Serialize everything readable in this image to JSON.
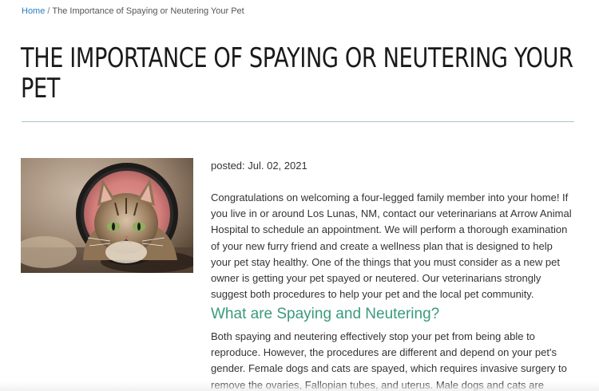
{
  "breadcrumb": {
    "home_label": "Home",
    "separator": "/",
    "current_label": "The Importance of Spaying or Neutering Your Pet"
  },
  "article": {
    "title": "THE IMPORTANCE OF SPAYING OR NEUTERING YOUR PET",
    "posted": "posted: Jul. 02, 2021",
    "intro": "Congratulations on welcoming a four-legged family member into your home! If you live in or around Los Lunas, NM, contact our veterinarians at Arrow Animal Hospital to schedule an appointment. We will perform a thorough examination of your new furry friend and create a wellness plan that is designed to help your pet stay healthy. One of the things that you must consider as a new pet owner is getting your pet spayed or neutered. Our veterinarians strongly suggest both procedures to help your pet and the local pet community.",
    "section_heading": "What are Spaying and Neutering?",
    "section_body": "Both spaying and neutering effectively stop your pet from being able to reproduce. However, the procedures are different and depend on your pet's gender. Female dogs and cats are spayed, which requires invasive surgery to remove the ovaries, Fallopian tubes, and uterus. Male dogs and cats are neutered, which is a less-invasive surgical"
  },
  "image": {
    "subject": "kitten wearing a recovery cone",
    "icon": "cat-in-cone-photo"
  },
  "colors": {
    "link": "#2e7bc4",
    "heading_accent": "#3a9a7d",
    "rule": "#a8c8cc",
    "text": "#333333"
  }
}
